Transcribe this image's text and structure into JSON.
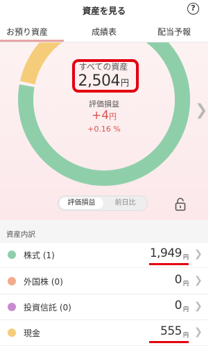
{
  "header": {
    "title": "資産を見る",
    "help_icon": "?"
  },
  "tabs": [
    {
      "label": "お預り資産",
      "active": true
    },
    {
      "label": "成績表",
      "active": false
    },
    {
      "label": "配当予報",
      "active": false
    }
  ],
  "summary": {
    "caption": "すべての資産",
    "total": "2,504",
    "unit": "円",
    "gain_label": "評価損益",
    "gain_amount": "+4",
    "gain_unit": "円",
    "gain_percent": "+0.16 %"
  },
  "ring": {
    "segments": [
      {
        "name": "株式",
        "share": 0.778,
        "color": "#8ecfaa"
      },
      {
        "name": "現金",
        "share": 0.222,
        "color": "#f5cd7a"
      }
    ]
  },
  "toggle": {
    "options": [
      "評価損益",
      "前日比"
    ],
    "selected": "評価損益"
  },
  "section": {
    "title": "資産内訳"
  },
  "assets": [
    {
      "label": "株式 (1)",
      "value": "1,949",
      "unit": "円",
      "color": "#8ecfaa"
    },
    {
      "label": "外国株 (0)",
      "value": "0",
      "unit": "円",
      "color": "#f2ab8c"
    },
    {
      "label": "投資信託 (0)",
      "value": "0",
      "unit": "円",
      "color": "#c98bd0"
    },
    {
      "label": "現金",
      "value": "555",
      "unit": "円",
      "color": "#f5cd7a"
    }
  ],
  "colors": {
    "accent": "#e3000f",
    "gain": "#d9534f"
  },
  "icons": {
    "help": "question-circle-icon",
    "lock": "lock-icon",
    "next": "chevron-right-icon"
  }
}
